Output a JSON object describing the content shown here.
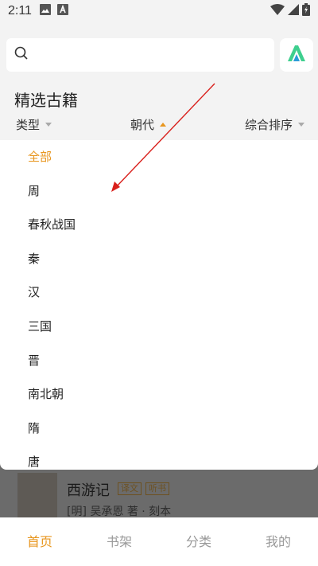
{
  "status_bar": {
    "time": "2:11"
  },
  "header": {
    "section_title": "精选古籍"
  },
  "filters": [
    {
      "label": "类型",
      "state": "collapsed"
    },
    {
      "label": "朝代",
      "state": "expanded"
    },
    {
      "label": "综合排序",
      "state": "collapsed"
    }
  ],
  "dropdown": {
    "items": [
      "全部",
      "周",
      "春秋战国",
      "秦",
      "汉",
      "三国",
      "晋",
      "南北朝",
      "隋",
      "唐"
    ],
    "selected_index": 0
  },
  "book": {
    "title": "西游记",
    "tags": [
      "译文",
      "听书"
    ],
    "meta": "[明] 吴承恩 著 · 刻本"
  },
  "bottom_nav": {
    "items": [
      "首页",
      "书架",
      "分类",
      "我的"
    ],
    "active_index": 0
  },
  "colors": {
    "accent": "#e8961e",
    "annotation_arrow": "#d9201c",
    "logo": "#3ecf8e"
  },
  "icons": {
    "search": "search-icon",
    "logo": "app-logo-icon"
  }
}
